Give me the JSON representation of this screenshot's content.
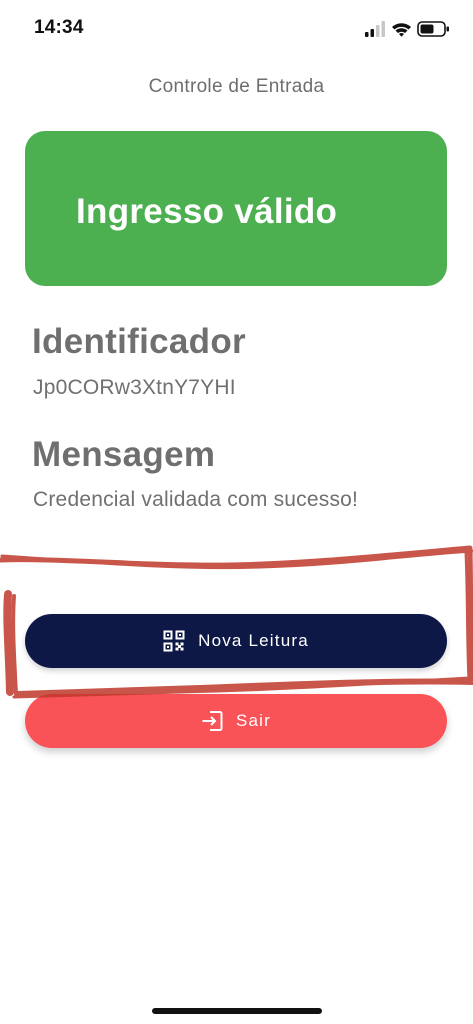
{
  "status_bar": {
    "time": "14:34",
    "icons": [
      "cellular-signal-icon",
      "wifi-icon",
      "battery-icon"
    ]
  },
  "header": {
    "title": "Controle de Entrada"
  },
  "result": {
    "banner_text": "Ingresso válido",
    "banner_color": "#4caf50"
  },
  "identifier": {
    "heading": "Identificador",
    "value": "Jp0CORw3XtnY7YHI"
  },
  "message": {
    "heading": "Mensagem",
    "value": "Credencial validada com sucesso!"
  },
  "actions": {
    "new_scan_label": "Nova Leitura",
    "new_scan_icon": "qr-code-icon",
    "new_scan_color": "#0d1846",
    "exit_label": "Sair",
    "exit_icon": "exit-icon",
    "exit_color": "#f95257"
  },
  "annotation_color": "#c0392b"
}
